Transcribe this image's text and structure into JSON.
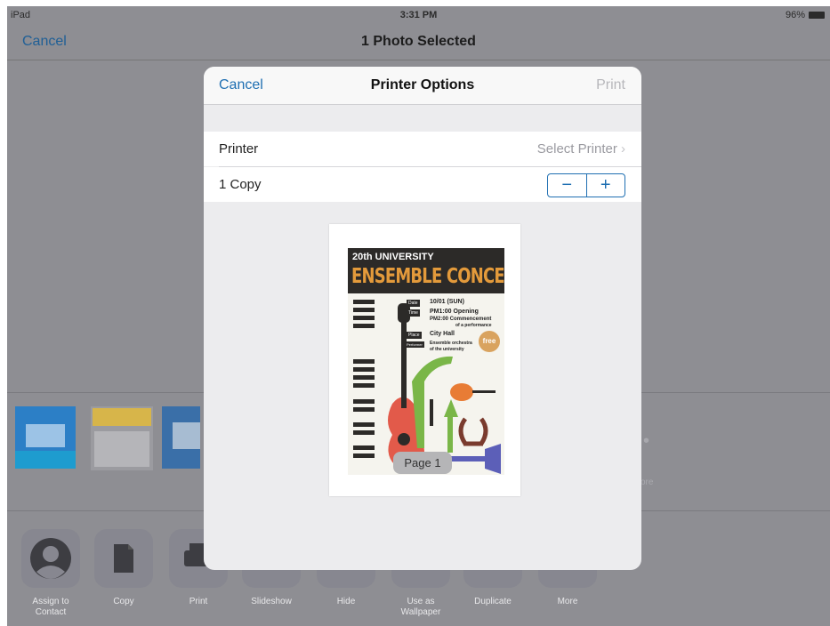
{
  "status_bar": {
    "device": "iPad",
    "time": "3:31 PM",
    "battery": "96%"
  },
  "background_nav": {
    "cancel": "Cancel",
    "title": "1 Photo Selected"
  },
  "background": {
    "more_label": "ore"
  },
  "actions": [
    {
      "label": "Assign to\nContact",
      "icon": "person-icon"
    },
    {
      "label": "Copy",
      "icon": "copy-icon"
    },
    {
      "label": "Print",
      "icon": "printer-icon"
    },
    {
      "label": "Slideshow",
      "icon": "play-icon"
    },
    {
      "label": "Hide",
      "icon": "hide-icon"
    },
    {
      "label": "Use as\nWallpaper",
      "icon": "wallpaper-icon"
    },
    {
      "label": "Duplicate",
      "icon": "duplicate-icon"
    },
    {
      "label": "More",
      "icon": "more-icon"
    }
  ],
  "printer_options": {
    "cancel": "Cancel",
    "title": "Printer Options",
    "print": "Print",
    "printer_label": "Printer",
    "printer_value": "Select Printer",
    "copies_label": "1 Copy",
    "stepper_minus": "−",
    "stepper_plus": "+",
    "page_badge": "Page 1"
  },
  "poster": {
    "line1": "20th UNIVERSITY",
    "line2": "ENSEMBLE CONCERT",
    "date_tag": "Date",
    "date_value": "10/01 (SUN)",
    "time_tag": "Time",
    "time_value1": "PM1:00 Opening",
    "time_value2": "PM2:00 Commencement",
    "time_value3": "of a performance",
    "place_tag": "Place",
    "place_value": "City Hall",
    "performer_tag": "Performer",
    "performer_value1": "Ensemble orchestra",
    "performer_value2": "of the university",
    "free": "free"
  },
  "colors": {
    "accent": "#1f6fb2",
    "dim": "#8e8e93",
    "modal": "#ececee",
    "poster_orange": "#e39a3b"
  }
}
